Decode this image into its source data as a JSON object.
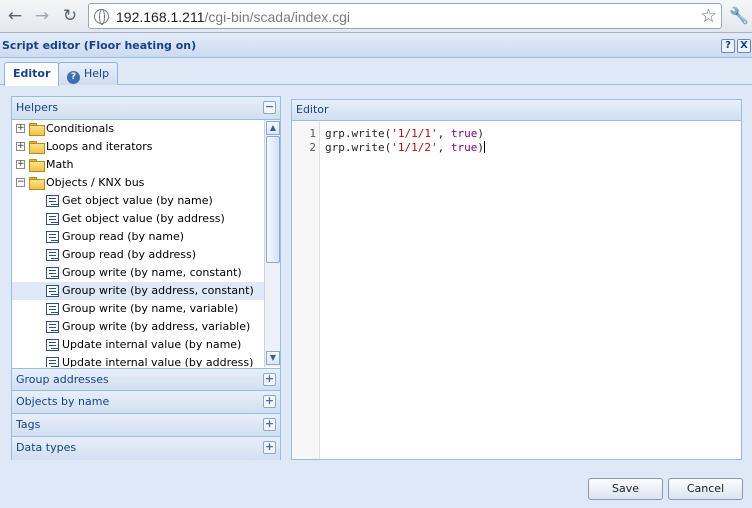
{
  "browser": {
    "url_host": "192.168.1.211",
    "url_path": "/cgi-bin/scada/index.cgi"
  },
  "window": {
    "title": "Script editor (Floor heating on)",
    "help_btn": "?",
    "close_btn": "X"
  },
  "tabs": [
    {
      "label": "Editor",
      "active": true
    },
    {
      "label": "Help",
      "active": false
    }
  ],
  "helpers": {
    "title": "Helpers",
    "collapse_glyph": "−",
    "tree": [
      {
        "label": "Conditionals",
        "type": "folder",
        "expander": "+"
      },
      {
        "label": "Loops and iterators",
        "type": "folder",
        "expander": "+"
      },
      {
        "label": "Math",
        "type": "folder",
        "expander": "+"
      },
      {
        "label": "Objects / KNX bus",
        "type": "folder",
        "expander": "−"
      },
      {
        "label": "Get object value (by name)",
        "type": "leaf"
      },
      {
        "label": "Get object value (by address)",
        "type": "leaf"
      },
      {
        "label": "Group read (by name)",
        "type": "leaf"
      },
      {
        "label": "Group read (by address)",
        "type": "leaf"
      },
      {
        "label": "Group write (by name, constant)",
        "type": "leaf"
      },
      {
        "label": "Group write (by address, constant)",
        "type": "leaf",
        "selected": true
      },
      {
        "label": "Group write (by name, variable)",
        "type": "leaf"
      },
      {
        "label": "Group write (by address, variable)",
        "type": "leaf"
      },
      {
        "label": "Update internal value (by name)",
        "type": "leaf"
      },
      {
        "label": "Update internal value (by address)",
        "type": "leaf"
      }
    ],
    "sections": [
      {
        "label": "Group addresses",
        "glyph": "+"
      },
      {
        "label": "Objects by name",
        "glyph": "+"
      },
      {
        "label": "Tags",
        "glyph": "+"
      },
      {
        "label": "Data types",
        "glyph": "+"
      }
    ]
  },
  "editor": {
    "title": "Editor",
    "lines": [
      {
        "num": "1",
        "fn": "grp.write(",
        "str": "'1/1/1'",
        "sep": ", ",
        "kw": "true",
        "end": ")"
      },
      {
        "num": "2",
        "fn": "grp.write(",
        "str": "'1/1/2'",
        "sep": ", ",
        "kw": "true",
        "end": ")"
      }
    ]
  },
  "footer": {
    "save_label": "Save",
    "cancel_label": "Cancel"
  },
  "icons": {
    "back": "back-arrow-icon",
    "forward": "forward-arrow-icon",
    "reload": "reload-icon",
    "globe": "globe-icon",
    "star": "star-icon",
    "wrench": "wrench-icon"
  }
}
